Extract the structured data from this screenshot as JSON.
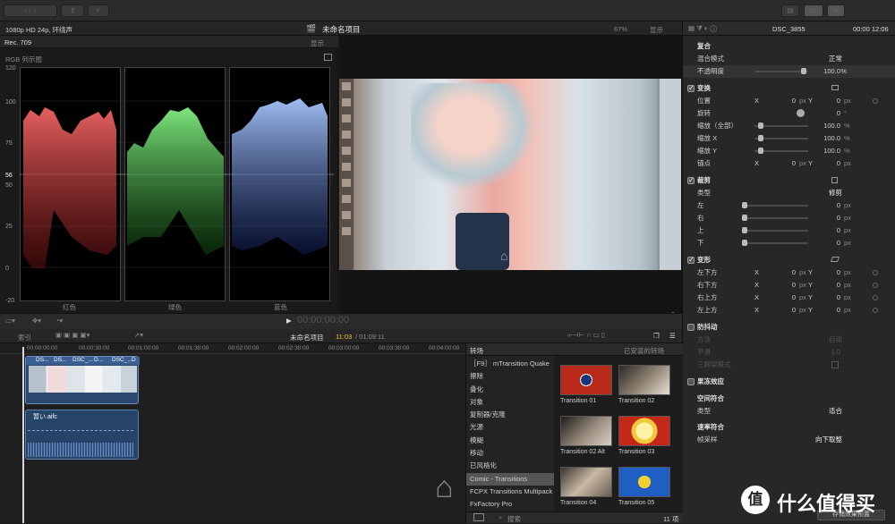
{
  "toolbar": {
    "format": "1080p HD 24p, 环绕声",
    "project_title": "未命名项目",
    "zoom": "67%",
    "view": "显示"
  },
  "scopes": {
    "standard": "Rec. 709",
    "view": "显示",
    "title": "RGB 列示图",
    "ticks": [
      "120",
      "100",
      "75",
      "56",
      "50",
      "25",
      "0",
      "-20"
    ],
    "channels": [
      "红色",
      "绿色",
      "蓝色"
    ]
  },
  "inspector": {
    "clip_name": "DSC_3855",
    "timecode": "00:00 12:06",
    "compositing": {
      "title": "复合",
      "blend_label": "混合模式",
      "blend_value": "正常",
      "opacity_label": "不透明度",
      "opacity_value": "100.0",
      "opacity_unit": "%"
    },
    "transform": {
      "title": "变换",
      "position_label": "位置",
      "rotation_label": "旋转",
      "scale_all_label": "缩放（全部）",
      "scale_x_label": "缩放 X",
      "scale_y_label": "缩放 Y",
      "anchor_label": "锚点",
      "x": "X",
      "y": "Y",
      "zero": "0",
      "px": "px",
      "deg": "°",
      "pct": "%",
      "hundred": "100.0"
    },
    "crop": {
      "title": "裁剪",
      "type_label": "类型",
      "type_value": "修剪",
      "left": "左",
      "right": "右",
      "top": "上",
      "bottom": "下"
    },
    "distort": {
      "title": "变形",
      "bl": "左下方",
      "br": "右下方",
      "tl": "左上方",
      "tr": "右上方"
    },
    "stabilize": {
      "title": "防抖动",
      "method": "方法",
      "method_value": "自动",
      "smoothing": "平滑",
      "smoothing_value": "1.0",
      "tripod": "三脚架模式"
    },
    "rolling": {
      "title": "果冻效应"
    },
    "spatial": {
      "title": "空间符合",
      "type_label": "类型",
      "type_value": "适合"
    },
    "rate": {
      "title": "速率符合",
      "frame_label": "帧采样",
      "frame_value": "向下取整"
    },
    "save_button": "存储效果预置"
  },
  "viewer": {
    "timecode": "00:00:00:00"
  },
  "timeline": {
    "index_label": "索引",
    "project": "未命名项目",
    "time_current": "11:03",
    "time_total": "/ 01:09:11",
    "ruler": [
      "00:00:00:00",
      "00:00:30:00",
      "00:01:00:00",
      "00:01:30:00",
      "00:02:00:00",
      "00:02:30:00",
      "00:03:00:00",
      "00:03:30:00",
      "00:04:00:00"
    ],
    "clips": [
      "DS...",
      "DS...",
      "DSC_...",
      "D...",
      "DSC_...",
      "D"
    ],
    "audio_clip": "暂い.aifc"
  },
  "transitions": {
    "title": "转场",
    "installed": "已安装的转场",
    "categories": [
      "［F9］ mTransition Quake",
      "擦除",
      "叠化",
      "对象",
      "复制器/克隆",
      "光源",
      "模糊",
      "移动",
      "已风格化",
      "Comic - Transitions",
      "FCPX Transitions Multipack",
      "FxFactory Pro"
    ],
    "selected_index": 9,
    "items": [
      "Transition 01",
      "Transition 02",
      "Transition 02 Alt",
      "Transition 03",
      "Transition 04",
      "Transition 05"
    ],
    "search_placeholder": "搜索",
    "count": "11 项"
  },
  "watermark": {
    "text": "什么值得买",
    "logo": "值"
  }
}
